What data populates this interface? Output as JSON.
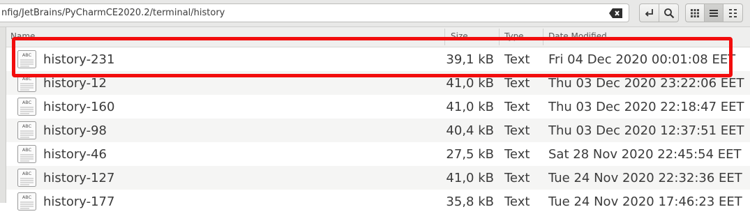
{
  "toolbar": {
    "path": "nfig/JetBrains/PyCharmCE2020.2/terminal/history"
  },
  "columns": {
    "name": "Name",
    "size": "Size",
    "type": "Type",
    "date": "Date Modified"
  },
  "files": [
    {
      "name": "history-231",
      "size": "39,1 kB",
      "type": "Text",
      "date": "Fri 04 Dec 2020 00:01:08 EET",
      "icon": "text-file-icon"
    },
    {
      "name": "history-12",
      "size": "41,0 kB",
      "type": "Text",
      "date": "Thu 03 Dec 2020 23:22:06 EET",
      "icon": "text-file-icon"
    },
    {
      "name": "history-160",
      "size": "41,0 kB",
      "type": "Text",
      "date": "Thu 03 Dec 2020 22:18:47 EET",
      "icon": "text-file-icon"
    },
    {
      "name": "history-98",
      "size": "40,4 kB",
      "type": "Text",
      "date": "Thu 03 Dec 2020 12:37:51 EET",
      "icon": "text-file-icon"
    },
    {
      "name": "history-46",
      "size": "27,5 kB",
      "type": "Text",
      "date": "Sat 28 Nov 2020 22:45:54 EET",
      "icon": "text-file-icon"
    },
    {
      "name": "history-127",
      "size": "41,0 kB",
      "type": "Text",
      "date": "Tue 24 Nov 2020 22:32:36 EET",
      "icon": "text-file-icon"
    },
    {
      "name": "history-177",
      "size": "35,8 kB",
      "type": "Text",
      "date": "Tue 24 Nov 2020 17:46:23 EET",
      "icon": "text-file-icon"
    }
  ],
  "icon_label": "ABC",
  "colors": {
    "highlight": "#f20d0d",
    "toolbar_bg": "#e8e8e7",
    "row_alt": "#f5f5f4"
  }
}
